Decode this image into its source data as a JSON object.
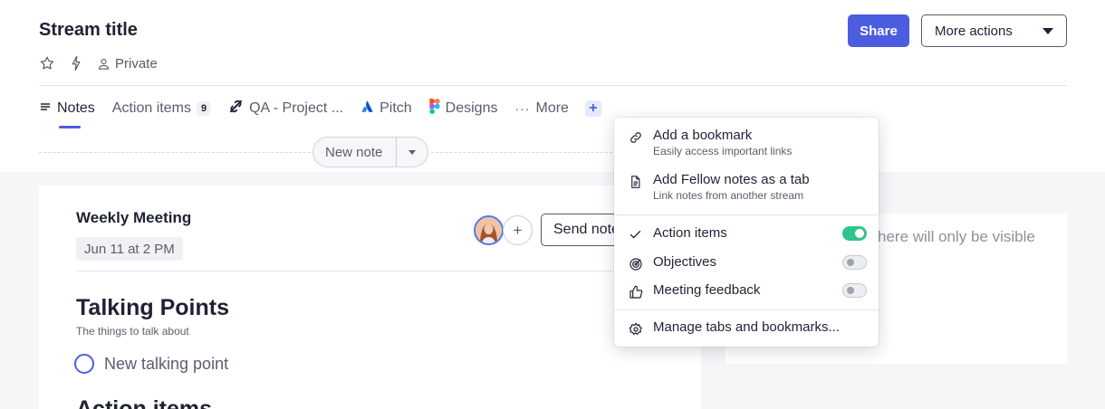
{
  "header": {
    "title": "Stream title",
    "privacy_label": "Private",
    "share_label": "Share",
    "more_actions_label": "More actions"
  },
  "tabs": [
    {
      "label": "Notes",
      "icon": "lines-icon"
    },
    {
      "label": "Action items",
      "badge": "9",
      "icon": ""
    },
    {
      "label": "QA - Project ...",
      "icon": "link-slash-icon"
    },
    {
      "label": "Pitch",
      "icon": "atlassian-icon"
    },
    {
      "label": "Designs",
      "icon": "figma-icon"
    },
    {
      "label": "More",
      "icon": "ellipsis-icon"
    }
  ],
  "new_note": {
    "label": "New note"
  },
  "meeting": {
    "title": "Weekly Meeting",
    "date": "Jun 11 at 2 PM",
    "send_notes_label": "Send notes"
  },
  "talking_points": {
    "title": "Talking Points",
    "subtitle": "The things to talk about",
    "new_item_placeholder": "New talking point"
  },
  "action_items_heading": "Action items",
  "side_panel_text": "here will only be visible",
  "menu": {
    "items": [
      {
        "label": "Add a bookmark",
        "description": "Easily access important links",
        "icon": "link-icon"
      },
      {
        "label": "Add Fellow notes as a tab",
        "description": "Link notes from another stream",
        "icon": "document-icon"
      },
      {
        "label": "Action items",
        "icon": "check-icon",
        "enabled": true
      },
      {
        "label": "Objectives",
        "icon": "target-icon",
        "enabled": false
      },
      {
        "label": "Meeting feedback",
        "icon": "thumbs-up-icon",
        "enabled": false
      },
      {
        "label": "Manage tabs and bookmarks...",
        "icon": "gear-icon"
      }
    ]
  },
  "colors": {
    "accent": "#4c5de0",
    "toggle_on": "#2fc48d",
    "text_primary": "#1f2233",
    "text_secondary": "#5a5e6d",
    "background_gray": "#f5f6f8"
  }
}
